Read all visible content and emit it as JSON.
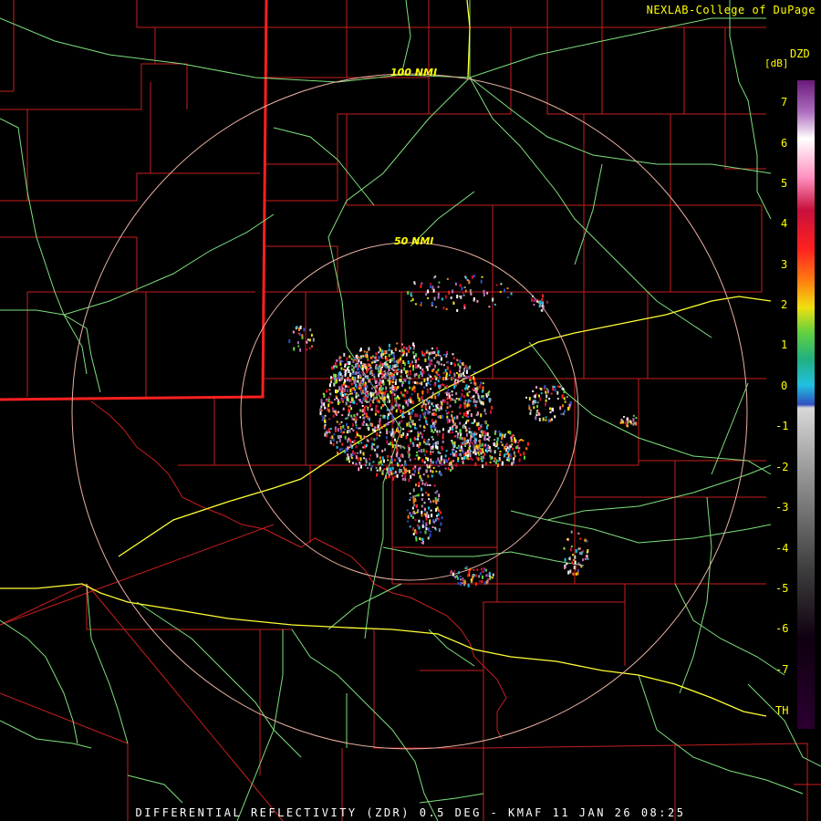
{
  "credit": "NEXLAB-College of DuPage",
  "product_line": "DIFFERENTIAL REFLECTIVITY (ZDR) 0.5 DEG - KMAF 11 JAN 26 08:25",
  "rings": {
    "inner_label": "50 NMI",
    "outer_label": "100 NMI"
  },
  "color_scale": {
    "code": "DZD",
    "unit": "[dB]",
    "ticks": [
      "7",
      "6",
      "5",
      "4",
      "3",
      "2",
      "1",
      "0",
      "-1",
      "-2",
      "-3",
      "-4",
      "-5",
      "-6",
      "-7",
      "TH"
    ]
  },
  "colors": {
    "county_lines": "#c81e1e",
    "state_border": "#ff2020",
    "highways": "#7ee07e",
    "interstates": "#ffff33",
    "range_rings": "#e8b0a0",
    "labels": "#ffff00"
  }
}
